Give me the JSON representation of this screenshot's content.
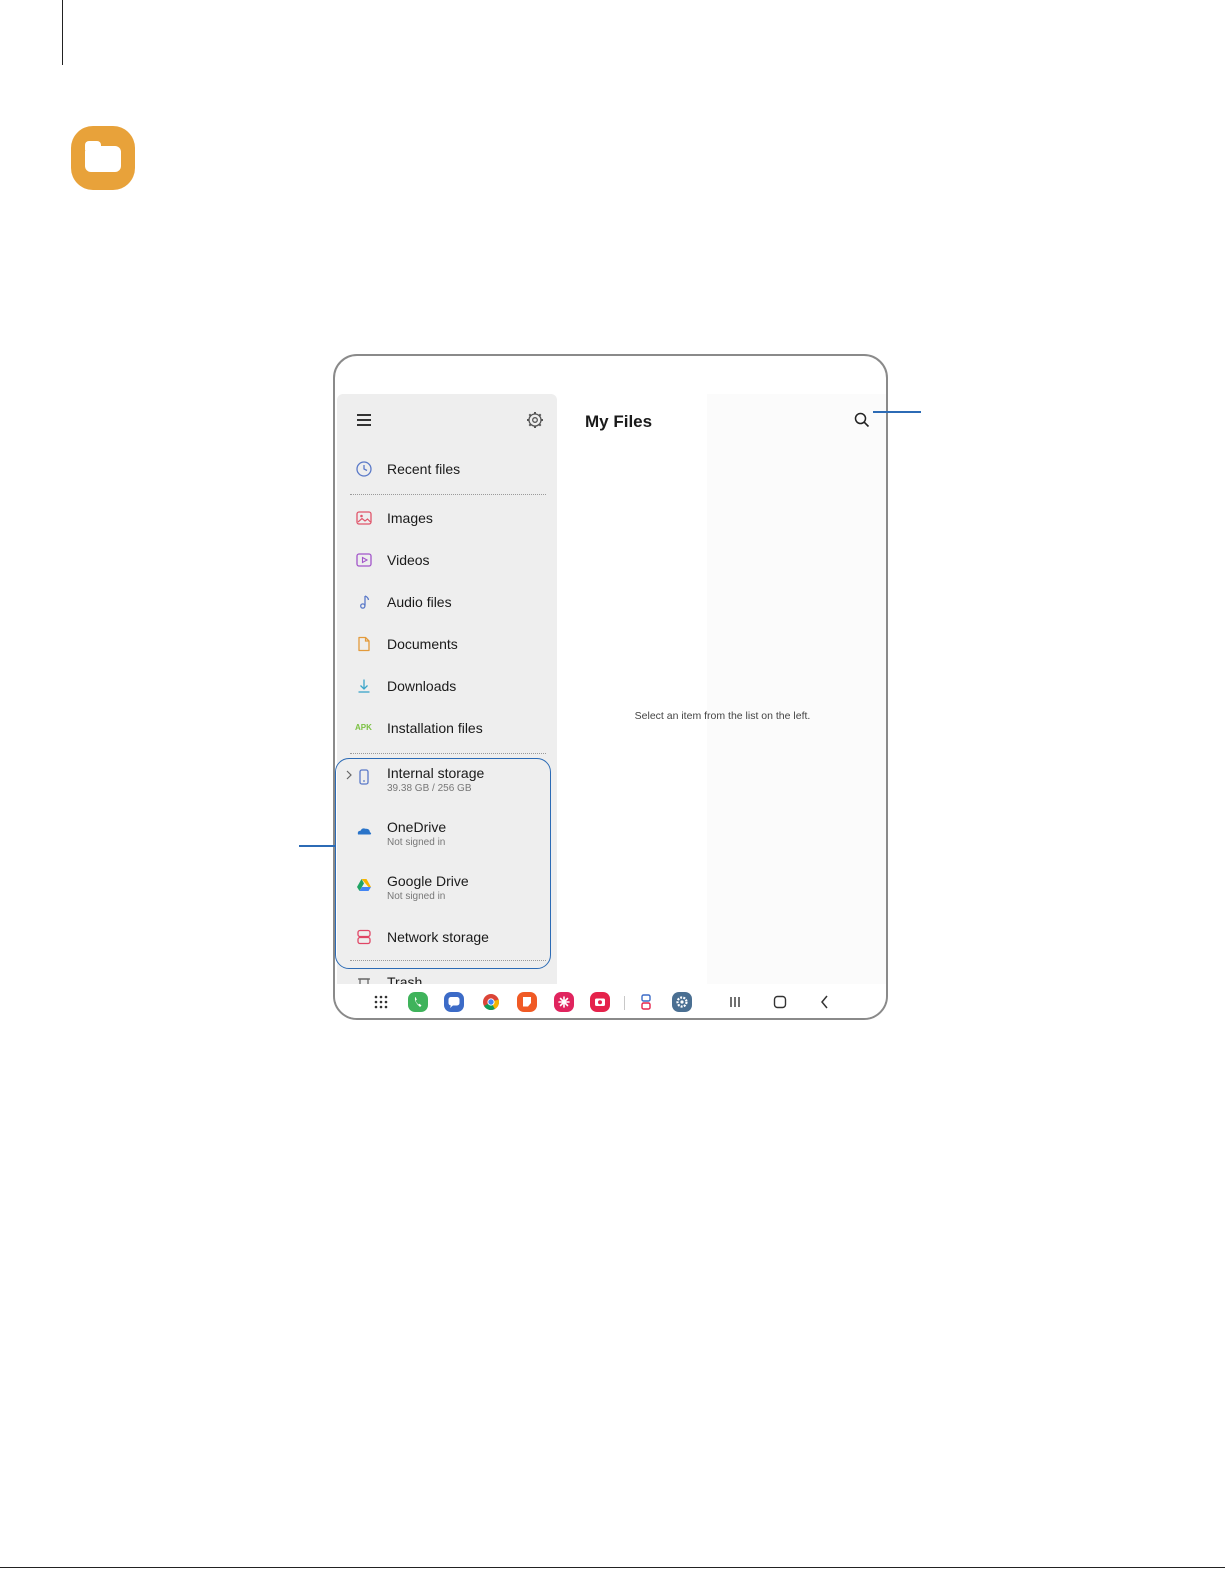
{
  "app": {
    "title": "My Files",
    "empty_message": "Select an item from the list on the left."
  },
  "sidebar": {
    "items": [
      {
        "label": "Recent files",
        "icon": "clock-icon"
      },
      {
        "label": "Images",
        "icon": "image-icon"
      },
      {
        "label": "Videos",
        "icon": "video-icon"
      },
      {
        "label": "Audio files",
        "icon": "music-note-icon"
      },
      {
        "label": "Documents",
        "icon": "document-icon"
      },
      {
        "label": "Downloads",
        "icon": "download-icon"
      },
      {
        "label": "Installation files",
        "icon": "apk-icon",
        "icon_text": "APK"
      },
      {
        "label": "Internal storage",
        "sublabel": "39.38 GB / 256 GB",
        "icon": "phone-icon"
      },
      {
        "label": "OneDrive",
        "sublabel": "Not signed in",
        "icon": "onedrive-icon"
      },
      {
        "label": "Google Drive",
        "sublabel": "Not signed in",
        "icon": "google-drive-icon"
      },
      {
        "label": "Network storage",
        "icon": "network-storage-icon"
      },
      {
        "label": "Trash",
        "icon": "trash-icon"
      }
    ]
  },
  "dock": {
    "apps": [
      "apps-grid-icon",
      "phone-app-icon",
      "messages-app-icon",
      "chrome-app-icon",
      "notes-app-icon",
      "bixby-app-icon",
      "camera-app-icon",
      "game-launcher-icon",
      "settings-app-icon"
    ],
    "system": [
      "recents-icon",
      "home-icon",
      "back-icon"
    ]
  },
  "colors": {
    "accent_callout": "#2c6bb5",
    "folder_logo": "#e8a23a",
    "sidebar_bg": "#eeeeee"
  }
}
